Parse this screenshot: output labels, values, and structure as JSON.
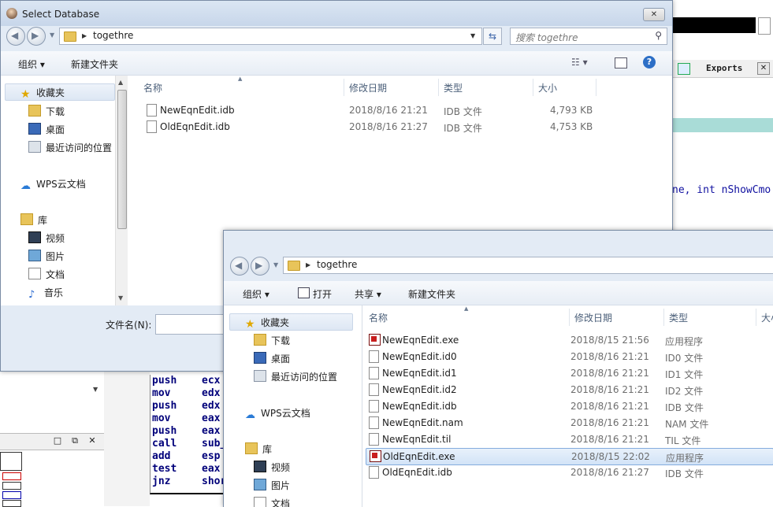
{
  "ida": {
    "exports_tab": "Exports",
    "exports_close": "✕",
    "code_fragment": "ne, int nShowCmo",
    "panel_buttons": [
      "□",
      "⧉",
      "✕"
    ],
    "asm": [
      {
        "op": "push",
        "arg": "ecx"
      },
      {
        "op": "mov",
        "arg": "edx"
      },
      {
        "op": "push",
        "arg": "edx"
      },
      {
        "op": "mov",
        "arg": "eax"
      },
      {
        "op": "push",
        "arg": "eax"
      },
      {
        "op": "call",
        "arg": "sub_"
      },
      {
        "op": "add",
        "arg": "esp"
      },
      {
        "op": "test",
        "arg": "eax"
      },
      {
        "op": "jnz",
        "arg": "shor"
      }
    ]
  },
  "dialog1": {
    "title": "Select Database",
    "close_label": "✕",
    "crumb": "togethre",
    "search_placeholder": "搜索 togethre",
    "toolbar": {
      "organize": "组织 ▾",
      "new_folder": "新建文件夹"
    },
    "nav": {
      "favorites": "收藏夹",
      "downloads": "下载",
      "desktop": "桌面",
      "recent": "最近访问的位置",
      "wps": "WPS云文档",
      "libraries": "库",
      "videos": "视频",
      "pictures": "图片",
      "documents": "文档",
      "music": "音乐"
    },
    "columns": {
      "name": "名称",
      "modified": "修改日期",
      "type": "类型",
      "size": "大小"
    },
    "files": [
      {
        "name": "NewEqnEdit.idb",
        "modified": "2018/8/16 21:21",
        "type": "IDB 文件",
        "size": "4,793 KB"
      },
      {
        "name": "OldEqnEdit.idb",
        "modified": "2018/8/16 21:27",
        "type": "IDB 文件",
        "size": "4,753 KB"
      }
    ],
    "filename_label": "文件名(N):"
  },
  "dialog2": {
    "crumb": "togethre",
    "toolbar": {
      "organize": "组织 ▾",
      "open": "打开",
      "share": "共享 ▾",
      "new_folder": "新建文件夹"
    },
    "nav": {
      "favorites": "收藏夹",
      "downloads": "下载",
      "desktop": "桌面",
      "recent": "最近访问的位置",
      "wps": "WPS云文档",
      "libraries": "库",
      "videos": "视频",
      "pictures": "图片",
      "documents": "文档"
    },
    "columns": {
      "name": "名称",
      "modified": "修改日期",
      "type": "类型",
      "size": "大小"
    },
    "files": [
      {
        "name": "NewEqnEdit.exe",
        "modified": "2018/8/15 21:56",
        "type": "应用程序",
        "icon": "exe"
      },
      {
        "name": "NewEqnEdit.id0",
        "modified": "2018/8/16 21:21",
        "type": "ID0 文件",
        "icon": "doc"
      },
      {
        "name": "NewEqnEdit.id1",
        "modified": "2018/8/16 21:21",
        "type": "ID1 文件",
        "icon": "doc"
      },
      {
        "name": "NewEqnEdit.id2",
        "modified": "2018/8/16 21:21",
        "type": "ID2 文件",
        "icon": "doc"
      },
      {
        "name": "NewEqnEdit.idb",
        "modified": "2018/8/16 21:21",
        "type": "IDB 文件",
        "icon": "doc"
      },
      {
        "name": "NewEqnEdit.nam",
        "modified": "2018/8/16 21:21",
        "type": "NAM 文件",
        "icon": "doc"
      },
      {
        "name": "NewEqnEdit.til",
        "modified": "2018/8/16 21:21",
        "type": "TIL 文件",
        "icon": "doc"
      },
      {
        "name": "OldEqnEdit.exe",
        "modified": "2018/8/15 22:02",
        "type": "应用程序",
        "icon": "exe",
        "selected": true
      },
      {
        "name": "OldEqnEdit.idb",
        "modified": "2018/8/16 21:27",
        "type": "IDB 文件",
        "icon": "doc"
      }
    ]
  }
}
